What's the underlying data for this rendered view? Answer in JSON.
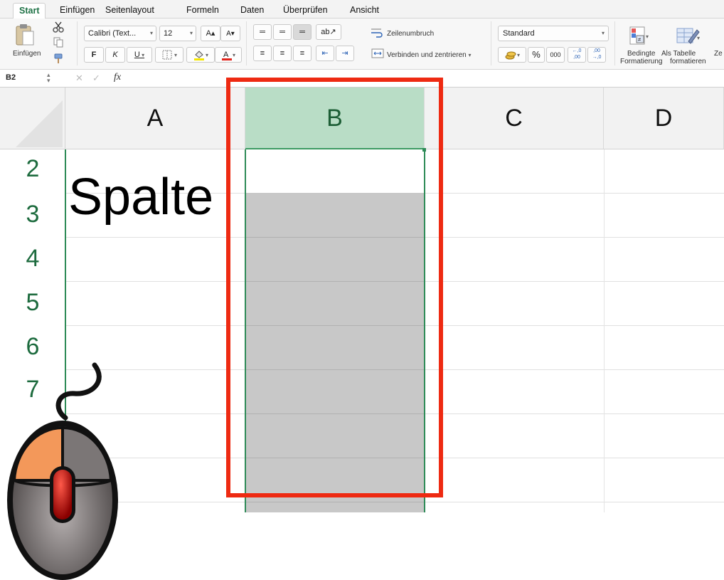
{
  "tabs": [
    "Start",
    "Einfügen",
    "Seitenlayout",
    "Formeln",
    "Daten",
    "Überprüfen",
    "Ansicht"
  ],
  "ribbon": {
    "paste_label": "Einfügen",
    "font_name": "Calibri (Text...",
    "font_size": "12",
    "bold": "F",
    "italic": "K",
    "underline": "U",
    "wrap_text": "Zeilenumbruch",
    "merge_center": "Verbinden und zentrieren",
    "number_format": "Standard",
    "percent": "%",
    "thousands": "000",
    "cond_format_line1": "Bedingte",
    "cond_format_line2": "Formatierung",
    "as_table_line1": "Als Tabelle",
    "as_table_line2": "formatieren",
    "cut_off": "Ze"
  },
  "formula_bar": {
    "name_box": "B2",
    "fx": "fx",
    "value": ""
  },
  "grid": {
    "columns": [
      "A",
      "B",
      "C",
      "D"
    ],
    "rows": [
      "2",
      "3",
      "4",
      "5",
      "6",
      "7"
    ],
    "selected_column": "B",
    "cell_A2": "Spalte"
  },
  "colors": {
    "accent_green": "#1e7145",
    "selected_header": "#b9ddc6",
    "selection_fill": "#c8c8c8",
    "highlight_frame": "#ee2a12"
  },
  "overlay": {
    "mouse_icon": "mouse-left-click-icon"
  }
}
